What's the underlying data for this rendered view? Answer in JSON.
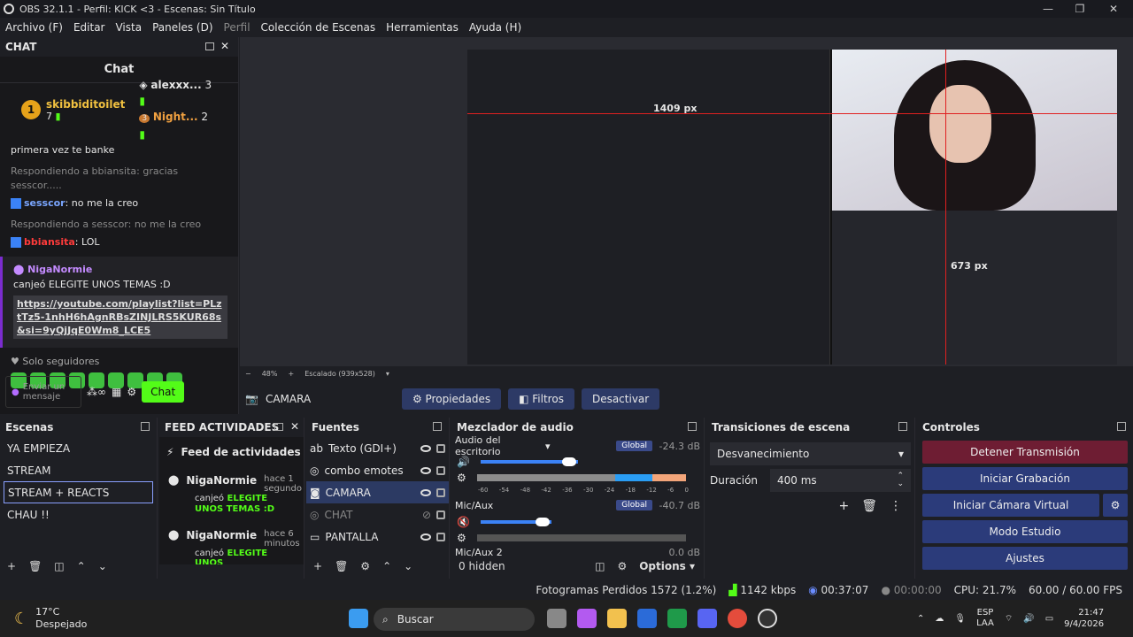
{
  "window": {
    "title": "OBS 32.1.1 - Perfil: KICK <3 - Escenas: Sin Título"
  },
  "menu": [
    "Archivo (F)",
    "Editar",
    "Vista",
    "Paneles (D)",
    "Perfil",
    "Colección de Escenas",
    "Herramientas",
    "Ayuda (H)"
  ],
  "chat": {
    "dock_title": "CHAT",
    "title": "Chat",
    "top1_name": "skibbiditoilet",
    "top1_rank": "1",
    "top1_count": "7",
    "top2_name": "alexxx...",
    "top2_count": "3",
    "top3_rank": "3",
    "top3_name": "Night...",
    "top3_count": "2",
    "msg0_text": "primera vez te banke",
    "reply1": "Respondiendo a bbiansita: gracias sesscor.....",
    "msg1_user": "sesscor",
    "msg1_text": ": no me la creo",
    "reply2": "Respondiendo a sesscor: no me la creo",
    "msg2_user": "bbiansita",
    "msg2_text": ": LOL",
    "redeem_user": "NigaNormie",
    "redeem_text": "canjeó",
    "redeem_reward": "ELEGITE UNOS TEMAS :D",
    "redeem_link": "https://youtube.com/playlist?list=PLztTz5-1nhH6hAgnRBsZINJLRS5KUR68s&si=9yQjJqE0Wm8_LCE5",
    "followers_only": "Solo seguidores",
    "input_placeholder": "Enviar un mensaje",
    "send_label": "Chat"
  },
  "preview": {
    "zoom": "48%",
    "scaling": "Escalado (939x528)",
    "overlay_width": "1409 px",
    "overlay_height": "673 px"
  },
  "source_bar": {
    "source": "CAMARA",
    "properties": "Propiedades",
    "filters": "Filtros",
    "deactivate": "Desactivar"
  },
  "scenes": {
    "title": "Escenas",
    "items": [
      "YA EMPIEZA",
      "STREAM",
      "STREAM + REACTS",
      "CHAU !!"
    ],
    "selected": 2
  },
  "feed": {
    "title": "FEED ACTIVIDADES",
    "header": "Feed de actividades",
    "items": [
      {
        "user": "NigaNormie",
        "time": "hace 1 segundo",
        "action": "canjeó",
        "reward": "ELEGITE UNOS TEMAS :D"
      },
      {
        "user": "NigaNormie",
        "time": "hace 6 minutos",
        "action": "canjeó",
        "reward": "ELEGITE UNOS"
      }
    ]
  },
  "sources": {
    "title": "Fuentes",
    "items": [
      "Texto (GDI+)",
      "combo emotes",
      "CAMARA",
      "CHAT",
      "PANTALLA"
    ],
    "selected": 2
  },
  "mixer": {
    "title": "Mezclador de audio",
    "ch1": "Audio del escritorio",
    "ch1_db": "-24.3 dB",
    "ch2": "Mic/Aux",
    "ch2_db": "-40.7 dB",
    "ch3": "Mic/Aux 2",
    "ch3_db": "0.0 dB",
    "global": "Global",
    "ticks": [
      "-60",
      "-54",
      "-48",
      "-42",
      "-36",
      "-30",
      "-24",
      "-18",
      "-12",
      "-6",
      "0"
    ],
    "hidden": "0 hidden",
    "options": "Options"
  },
  "transitions": {
    "title": "Transiciones de escena",
    "type": "Desvanecimiento",
    "duration_label": "Duración",
    "duration": "400 ms"
  },
  "controls": {
    "title": "Controles",
    "stop_stream": "Detener Transmisión",
    "record": "Iniciar Grabación",
    "virtual_cam": "Iniciar Cámara Virtual",
    "studio": "Modo Estudio",
    "settings": "Ajustes"
  },
  "status": {
    "dropped": "Fotogramas Perdidos 1572 (1.2%)",
    "bitrate": "1142 kbps",
    "stream_time": "00:37:07",
    "rec_time": "00:00:00",
    "cpu": "CPU: 21.7%",
    "fps": "60.00 / 60.00 FPS"
  },
  "taskbar": {
    "weather_temp": "17°C",
    "weather_desc": "Despejado",
    "search": "Buscar",
    "lang1": "ESP",
    "lang2": "LAA",
    "time": "21:47",
    "date": "9/4/2026"
  }
}
